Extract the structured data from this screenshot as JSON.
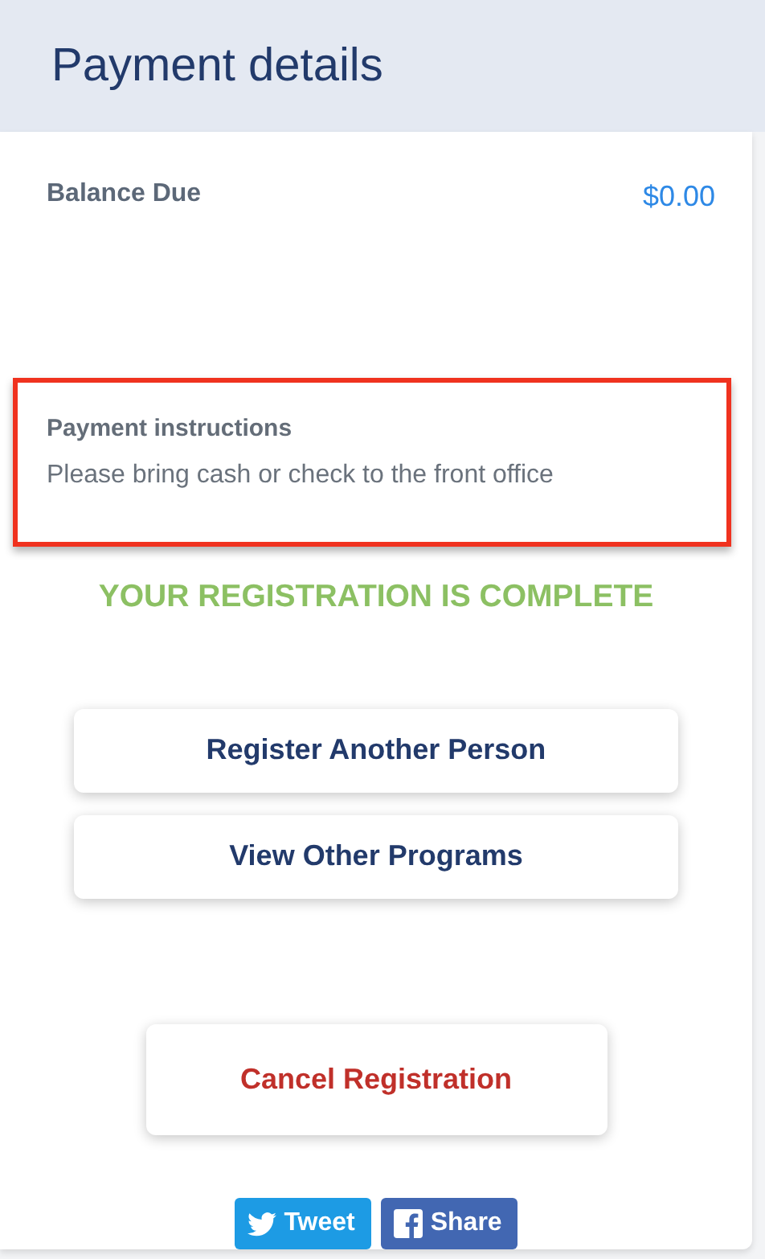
{
  "header": {
    "title": "Payment details"
  },
  "balance": {
    "label": "Balance Due",
    "value": "$0.00"
  },
  "instructions": {
    "title": "Payment instructions",
    "text": "Please bring cash or check to the front office"
  },
  "status": "YOUR REGISTRATION IS COMPLETE",
  "actions": [
    {
      "label": "Register Another Person",
      "kind": "primary"
    },
    {
      "label": "View Other Programs",
      "kind": "primary"
    },
    {
      "label": "Cancel Registration",
      "kind": "danger"
    }
  ],
  "social": [
    {
      "label": "Tweet",
      "kind": "twitter"
    },
    {
      "label": "Share",
      "kind": "facebook"
    }
  ]
}
